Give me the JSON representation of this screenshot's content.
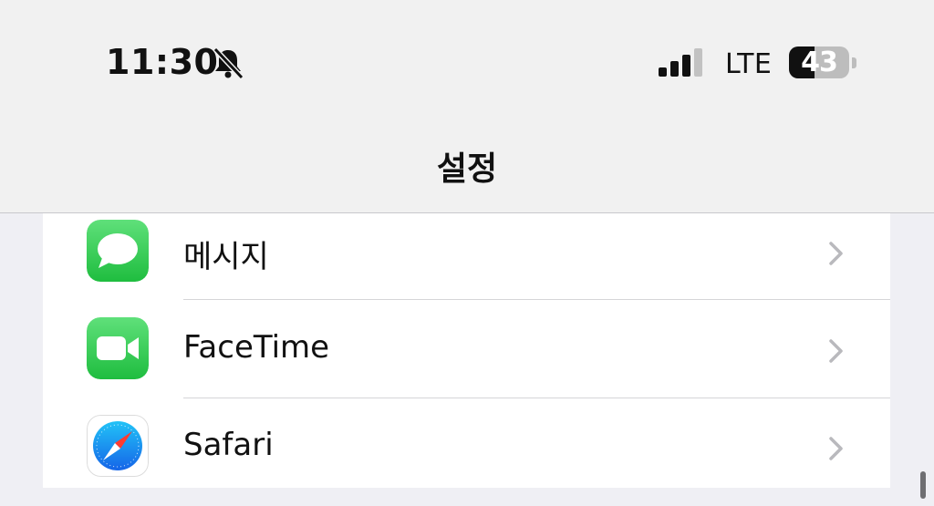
{
  "status_bar": {
    "time": "11:30",
    "network": "LTE",
    "battery_percent": 43,
    "battery_label": "43",
    "bell_icon": "bell-slash-icon",
    "signal_icon": "cellular-signal-icon"
  },
  "nav": {
    "title": "설정"
  },
  "settings": {
    "items": [
      {
        "label": "메시지",
        "icon": "messages-app-icon",
        "color": "#34c759"
      },
      {
        "label": "FaceTime",
        "icon": "facetime-app-icon",
        "color": "#34c759"
      },
      {
        "label": "Safari",
        "icon": "safari-app-icon",
        "color": "#1a8cff"
      }
    ]
  }
}
